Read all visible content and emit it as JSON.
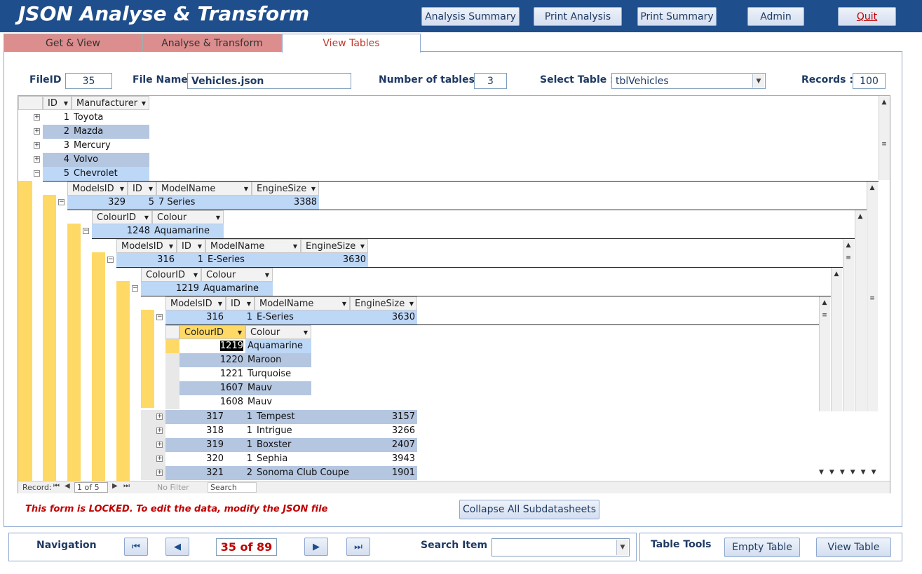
{
  "app": {
    "title": "JSON Analyse & Transform"
  },
  "header_buttons": {
    "analysis_summary": "Analysis Summary",
    "print_analysis": "Print Analysis",
    "print_summary": "Print Summary",
    "admin": "Admin",
    "quit": "Quit"
  },
  "tabs": [
    {
      "label": "Get & View"
    },
    {
      "label": "Analyse & Transform"
    },
    {
      "label": "View Tables"
    }
  ],
  "fields": {
    "fileid_label": "FileID :",
    "fileid_value": "35",
    "filename_label": "File Name :",
    "filename_value": "Vehicles.json",
    "numtables_label": "Number of tables :",
    "numtables_value": "3",
    "selecttable_label": "Select Table :",
    "selecttable_value": "tblVehicles",
    "records_label": "Records :",
    "records_value": "100"
  },
  "level1": {
    "headers": [
      "ID",
      "Manufacturer"
    ],
    "rows": [
      {
        "id": "1",
        "name": "Toyota"
      },
      {
        "id": "2",
        "name": "Mazda"
      },
      {
        "id": "3",
        "name": "Mercury"
      },
      {
        "id": "4",
        "name": "Volvo"
      },
      {
        "id": "5",
        "name": "Chevrolet"
      }
    ]
  },
  "models_headers": [
    "ModelsID",
    "ID",
    "ModelName",
    "EngineSize"
  ],
  "colour_headers": [
    "ColourID",
    "Colour"
  ],
  "level2": {
    "models_id": "329",
    "id": "5",
    "model_name": "7 Series",
    "engine_size": "3388"
  },
  "level3": {
    "colour_id": "1248",
    "colour": "Aquamarine"
  },
  "level4": {
    "models_id": "316",
    "id": "1",
    "model_name": "E-Series",
    "engine_size": "3630"
  },
  "level5": {
    "colour_id": "1219",
    "colour": "Aquamarine"
  },
  "level6": {
    "models_id": "316",
    "id": "1",
    "model_name": "E-Series",
    "engine_size": "3630"
  },
  "level7": {
    "rows": [
      {
        "colour_id": "1219",
        "colour": "Aquamarine"
      },
      {
        "colour_id": "1220",
        "colour": "Maroon"
      },
      {
        "colour_id": "1221",
        "colour": "Turquoise"
      },
      {
        "colour_id": "1607",
        "colour": "Mauv"
      },
      {
        "colour_id": "1608",
        "colour": "Mauv"
      }
    ]
  },
  "level6_more": [
    {
      "models_id": "317",
      "id": "1",
      "model_name": "Tempest",
      "engine_size": "3157"
    },
    {
      "models_id": "318",
      "id": "1",
      "model_name": "Intrigue",
      "engine_size": "3266"
    },
    {
      "models_id": "319",
      "id": "1",
      "model_name": "Boxster",
      "engine_size": "2407"
    },
    {
      "models_id": "320",
      "id": "1",
      "model_name": "Sephia",
      "engine_size": "3943"
    },
    {
      "models_id": "321",
      "id": "2",
      "model_name": "Sonoma Club Coupe",
      "engine_size": "1901"
    }
  ],
  "record_nav": {
    "label": "Record:",
    "position": "1 of 5",
    "filter": "No Filter",
    "search": "Search"
  },
  "locked_message": "This form is LOCKED. To edit the data, modify the JSON file",
  "collapse_button": "Collapse All Subdatasheets",
  "navigation": {
    "label": "Navigation",
    "counter": "35 of 89",
    "search_label": "Search Item",
    "search_value": ""
  },
  "table_tools": {
    "label": "Table Tools",
    "empty_button": "Empty Table",
    "view_button": "View Table"
  },
  "icons": [
    "first-record-icon",
    "prev-record-icon",
    "next-record-icon",
    "last-record-icon",
    "expand-icon",
    "collapse-icon",
    "dropdown-arrow-icon"
  ]
}
